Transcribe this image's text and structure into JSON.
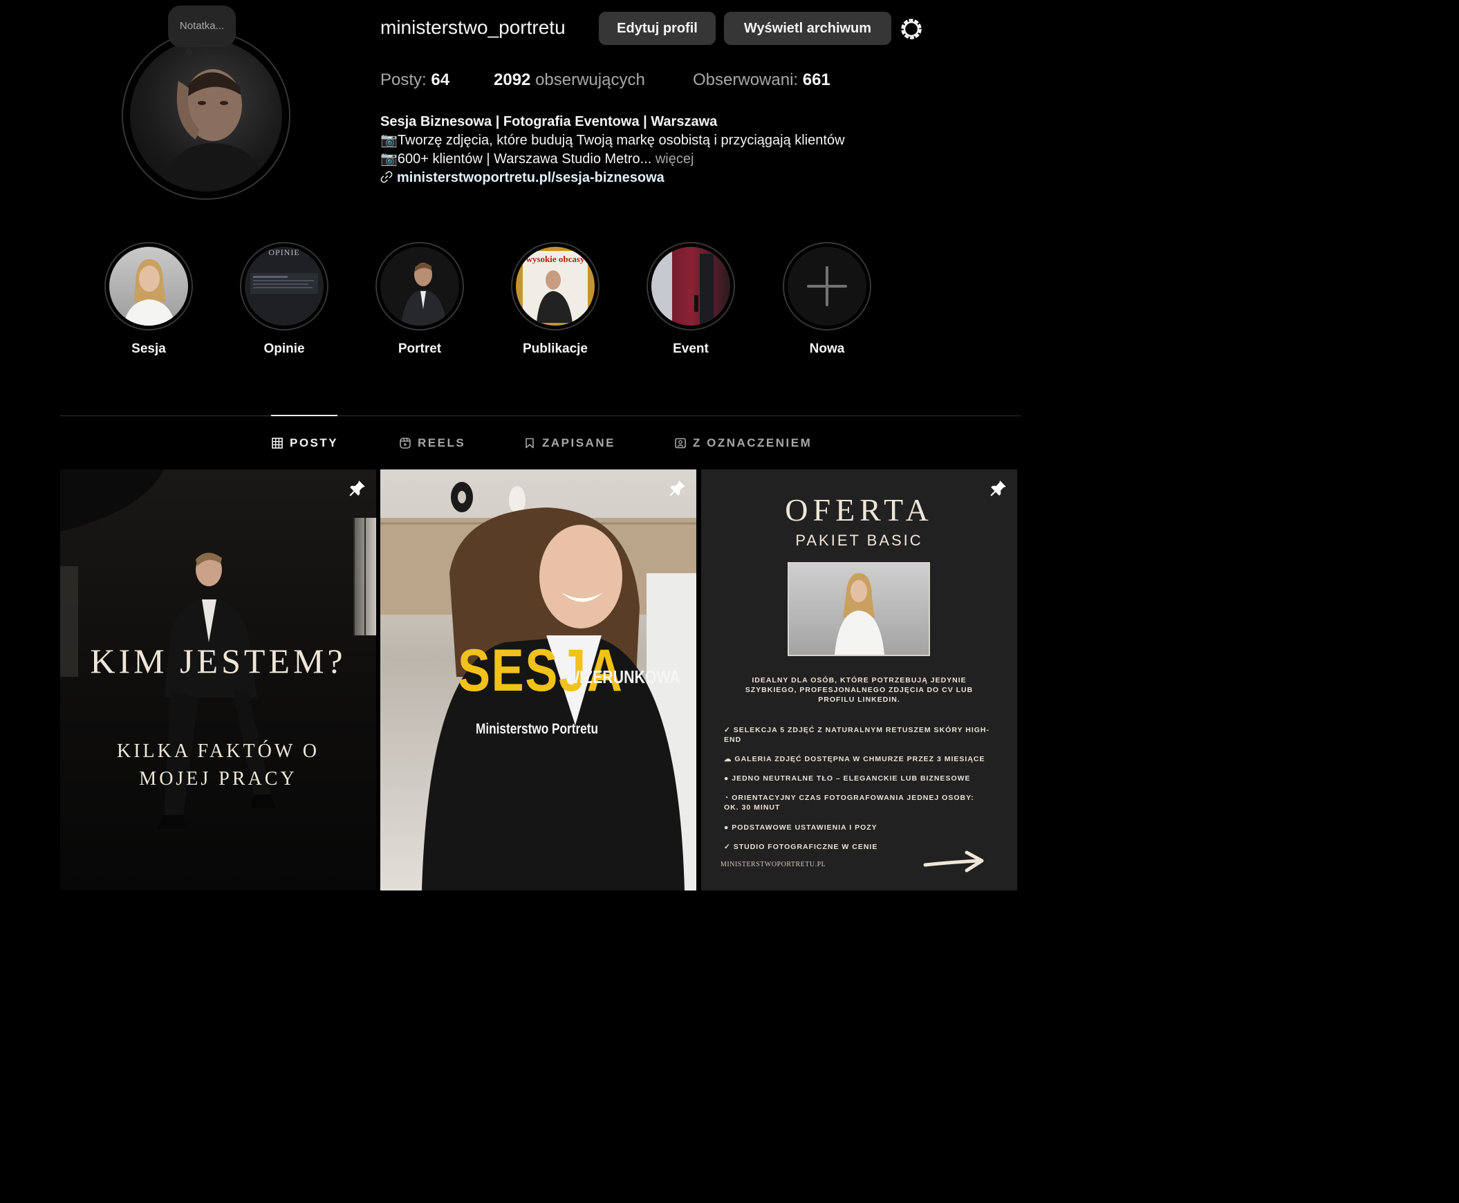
{
  "note": "Notatka...",
  "username": "ministerstwo_portretu",
  "buttons": {
    "edit_profile": "Edytuj profil",
    "view_archive": "Wyświetl archiwum"
  },
  "stats": {
    "posts_label": "Posty:",
    "posts_value": "64",
    "followers_value": "2092",
    "followers_label": "obserwujących",
    "following_label": "Obserwowani:",
    "following_value": "661"
  },
  "bio": {
    "name": "Sesja Biznesowa | Fotografia Eventowa | Warszawa",
    "line1": "📷Tworzę zdjęcia, które budują Twoją markę osobistą i przyciągają klientów",
    "line2": "📷600+ klientów | Warszawa Studio Metro...",
    "more": "więcej",
    "link": "ministerstwoportretu.pl/sesja-biznesowa"
  },
  "highlights": [
    {
      "label": "Sesja"
    },
    {
      "label": "Opinie",
      "cover_text": "OPINIE"
    },
    {
      "label": "Portret"
    },
    {
      "label": "Publikacje",
      "cover_text": "wysokie obcasy"
    },
    {
      "label": "Event"
    },
    {
      "label": "Nowa"
    }
  ],
  "tabs": [
    {
      "label": "POSTY",
      "icon": "grid-icon",
      "active": true
    },
    {
      "label": "REELS",
      "icon": "reels-icon",
      "active": false
    },
    {
      "label": "ZAPISANE",
      "icon": "bookmark-icon",
      "active": false
    },
    {
      "label": "Z OZNACZENIEM",
      "icon": "tagged-icon",
      "active": false
    }
  ],
  "posts": {
    "p1": {
      "title": "KIM JESTEM?",
      "subtitle": "KILKA FAKTÓW O MOJEJ PRACY"
    },
    "p2": {
      "title": "SESJA",
      "subtitle": "WIZERUNKOWA",
      "brand": "Ministerstwo Portretu"
    },
    "p3": {
      "title": "OFERTA",
      "subtitle": "PAKIET BASIC",
      "intro": "IDEALNY DLA OSÓB, KTÓRE POTRZEBUJĄ JEDYNIE SZYBKIEGO, PROFESJONALNEGO ZDJĘCIA DO CV LUB PROFILU LINKEDIN.",
      "items": [
        "✓  SELEKCJA 5 ZDJĘĆ Z NATURALNYM RETUSZEM SKÓRY HIGH-END",
        "☁  GALERIA ZDJĘĆ DOSTĘPNA W CHMURZE PRZEZ 3 MIESIĄCE",
        "●  JEDNO NEUTRALNE TŁO – ELEGANCKIE LUB BIZNESOWE",
        "◔  ORIENTACYJNY CZAS FOTOGRAFOWANIA JEDNEJ OSOBY: OK. 30 MINUT",
        "●  PODSTAWOWE USTAWIENIA I POZY",
        "✓  STUDIO FOTOGRAFICZNE W CENIE"
      ],
      "footer": "MINISTERSTWOPORTRETU.PL"
    }
  },
  "colors": {
    "bg": "#000000",
    "button": "#363636",
    "muted": "#a8a8a8",
    "text": "#f5f5f5",
    "accent_yellow": "#f2c21b",
    "link": "#e0f1ff"
  }
}
